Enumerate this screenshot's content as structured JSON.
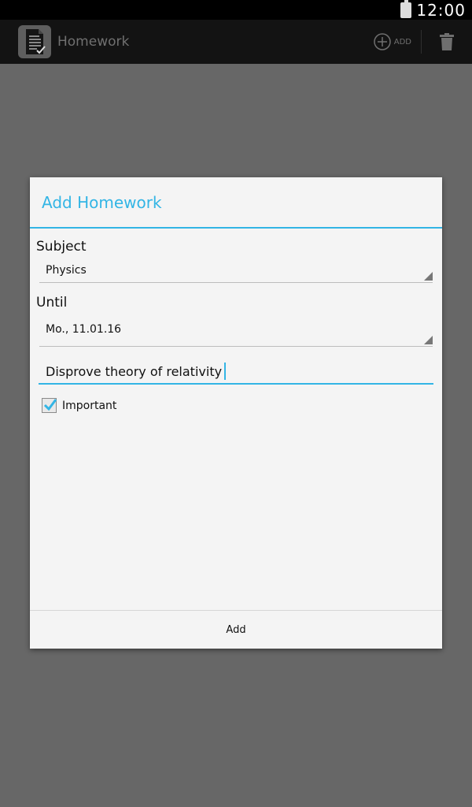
{
  "status_bar": {
    "time": "12:00"
  },
  "action_bar": {
    "title": "Homework",
    "add_label": "ADD",
    "icons": {
      "app": "homework-app-icon",
      "add": "add-circle-icon",
      "delete": "trash-icon"
    }
  },
  "dialog": {
    "title": "Add Homework",
    "subject_label": "Subject",
    "subject_value": "Physics",
    "until_label": "Until",
    "until_value": "Mo., 11.01.16",
    "description_value": "Disprove theory of relativity",
    "important_label": "Important",
    "important_checked": true,
    "add_button_label": "Add"
  },
  "colors": {
    "accent": "#33b5e5",
    "dim_background": "#676767",
    "action_bar": "#131313",
    "dialog_background": "#f4f4f4"
  }
}
